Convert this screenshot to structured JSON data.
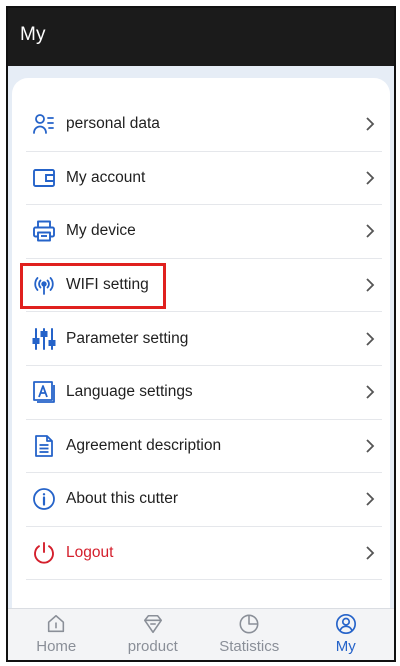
{
  "header": {
    "title": "My"
  },
  "menu": {
    "items": [
      {
        "label": "personal data",
        "icon": "person-list-icon"
      },
      {
        "label": "My account",
        "icon": "wallet-icon"
      },
      {
        "label": "My device",
        "icon": "printer-icon"
      },
      {
        "label": "WIFI setting",
        "icon": "wifi-signal-icon"
      },
      {
        "label": "Parameter setting",
        "icon": "sliders-icon"
      },
      {
        "label": "Language settings",
        "icon": "language-icon"
      },
      {
        "label": "Agreement description",
        "icon": "document-icon"
      },
      {
        "label": "About this cutter",
        "icon": "info-icon"
      },
      {
        "label": "Logout",
        "icon": "power-icon"
      }
    ]
  },
  "tabbar": {
    "tabs": [
      {
        "label": "Home",
        "icon": "home-icon",
        "active": false
      },
      {
        "label": "product",
        "icon": "gem-icon",
        "active": false
      },
      {
        "label": "Statistics",
        "icon": "pie-chart-icon",
        "active": false
      },
      {
        "label": "My",
        "icon": "user-circle-icon",
        "active": true
      }
    ]
  },
  "colors": {
    "accent": "#2563c9",
    "danger": "#d41f2c",
    "highlight": "#e0201e",
    "topbar": "#1b1b1b",
    "inactive_tab": "#8a8f98"
  }
}
